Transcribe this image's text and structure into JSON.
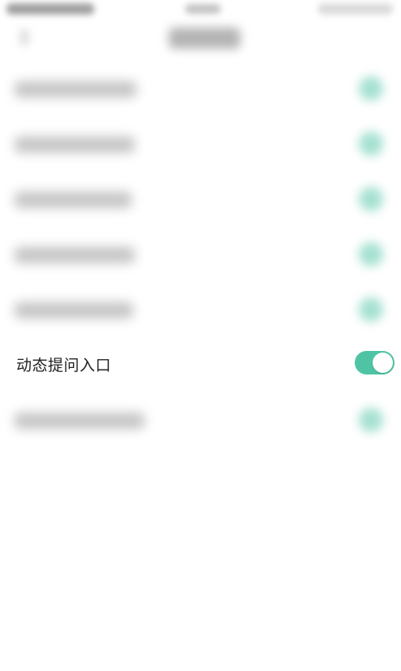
{
  "settings": {
    "items": [
      {
        "label": "",
        "enabled": true
      },
      {
        "label": "",
        "enabled": true
      },
      {
        "label": "",
        "enabled": true
      },
      {
        "label": "",
        "enabled": true
      },
      {
        "label": "",
        "enabled": true
      },
      {
        "label": "动态提问入口",
        "enabled": true
      },
      {
        "label": "",
        "enabled": true
      }
    ]
  },
  "colors": {
    "toggle_on": "#4fc4a4",
    "text": "#222222",
    "background": "#ffffff"
  }
}
